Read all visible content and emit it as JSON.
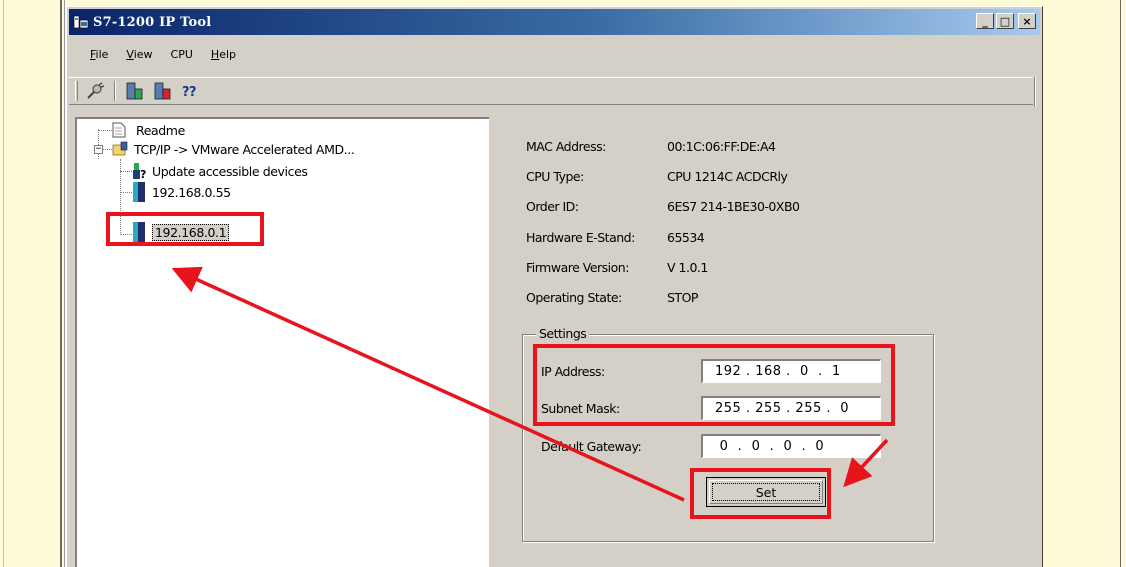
{
  "window": {
    "title": "S7-1200 IP Tool",
    "controls": {
      "minimize": "_",
      "maximize": "□",
      "close": "×"
    }
  },
  "menu": [
    {
      "label": "File",
      "mnemonic": "F",
      "rest": "ile"
    },
    {
      "label": "View",
      "mnemonic": "V",
      "rest": "iew"
    },
    {
      "label": "CPU",
      "mnemonic": "",
      "rest": "CPU"
    },
    {
      "label": "Help",
      "mnemonic": "H",
      "rest": "elp"
    }
  ],
  "toolbar": {
    "icons": [
      "connect-icon",
      "run-cpu-icon",
      "stop-cpu-icon",
      "help-icon"
    ]
  },
  "tree": {
    "readme": "Readme",
    "network": "TCP/IP -> VMware Accelerated AMD...",
    "update": "Update accessible devices",
    "device1": "192.168.0.55",
    "device2": "192.168.0.1"
  },
  "details": {
    "mac_label": "MAC Address:",
    "mac_value": "00:1C:06:FF:DE:A4",
    "cpu_label": "CPU Type:",
    "cpu_value": "CPU 1214C ACDCRly",
    "order_label": "Order ID:",
    "order_value": "6ES7 214-1BE30-0XB0",
    "hw_label": "Hardware E-Stand:",
    "hw_value": "65534",
    "fw_label": "Firmware Version:",
    "fw_value": "V 1.0.1",
    "state_label": "Operating State:",
    "state_value": "STOP"
  },
  "settings": {
    "title": "Settings",
    "ip_label": "IP Address:",
    "ip_value": "192 . 168 .  0  .  1",
    "mask_label": "Subnet Mask:",
    "mask_value": "255 . 255 . 255 .  0",
    "gateway_label": "Default Gateway:",
    "gateway_value": " 0  .  0  .  0  .  0",
    "set_label": "Set"
  },
  "colors": {
    "annotation": "#e8141c",
    "page_background": "#fdfbd6",
    "window_background": "#d4d0c8"
  }
}
